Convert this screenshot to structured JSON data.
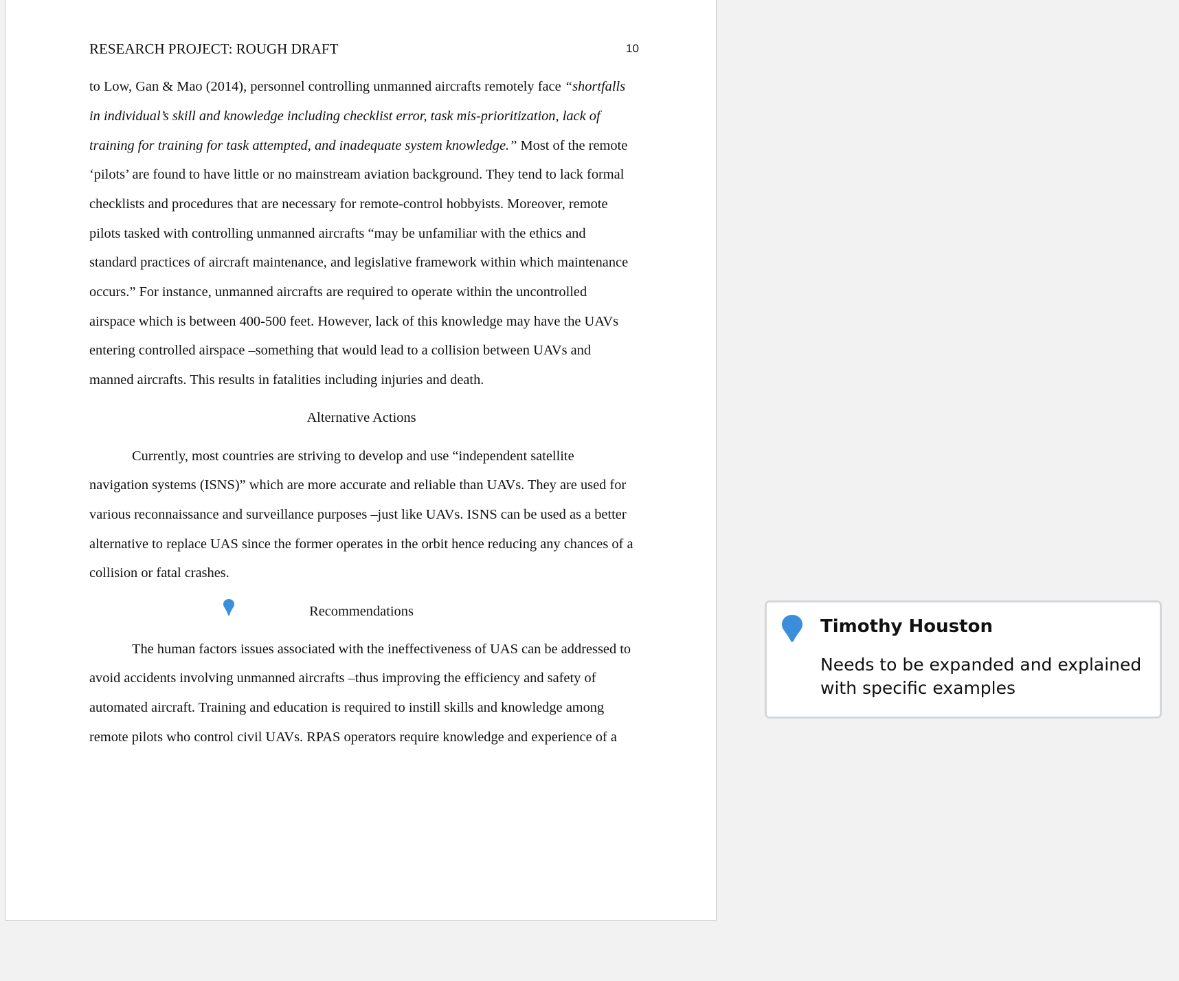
{
  "document": {
    "running_head": "RESEARCH PROJECT: ROUGH DRAFT",
    "page_number": "10",
    "lines": [
      {
        "pre": "to Low, Gan & Mao (2014), personnel controlling unmanned aircrafts remotely face ",
        "italic": "“shortfalls",
        "post": ""
      },
      {
        "pre": "",
        "italic": "in individual’s skill and knowledge including checklist error, task mis-prioritization, lack of",
        "post": ""
      },
      {
        "pre": "",
        "italic": "training for training for task attempted, and inadequate system knowledge.”",
        "post": " Most of the remote"
      },
      {
        "pre": "‘pilots’ are found to have little or no mainstream aviation background. They tend to lack formal",
        "italic": "",
        "post": ""
      },
      {
        "pre": "checklists and procedures that are necessary for remote-control hobbyists. Moreover, remote",
        "italic": "",
        "post": ""
      },
      {
        "pre": "pilots tasked with controlling unmanned aircrafts “may be unfamiliar with the ethics and",
        "italic": "",
        "post": ""
      },
      {
        "pre": "standard practices of aircraft maintenance, and legislative framework within which maintenance",
        "italic": "",
        "post": ""
      },
      {
        "pre": "occurs.” For instance, unmanned aircrafts are required to operate within the uncontrolled",
        "italic": "",
        "post": ""
      },
      {
        "pre": "airspace which is between 400-500 feet. However, lack of this knowledge may have the UAVs",
        "italic": "",
        "post": ""
      },
      {
        "pre": "entering controlled airspace –something that would lead to a collision between UAVs and",
        "italic": "",
        "post": ""
      },
      {
        "pre": "manned aircrafts. This results in fatalities including injuries and death.",
        "italic": "",
        "post": ""
      }
    ],
    "heading_alternative": "Alternative Actions",
    "alt_lines": [
      "Currently, most countries are striving to develop and use “independent satellite",
      "navigation systems (ISNS)” which are more accurate and reliable than UAVs. They are used for",
      "various reconnaissance and surveillance purposes –just like UAVs. ISNS can be used as a better",
      "alternative to replace UAS since the former operates in the orbit hence reducing any chances of a",
      "collision or fatal crashes."
    ],
    "heading_recommendations": "Recommendations",
    "rec_lines": [
      "The human factors issues associated with the ineffectiveness of UAS can be addressed to",
      "avoid accidents involving unmanned aircrafts –thus improving the efficiency and safety of",
      "automated aircraft. Training and education is required to instill skills and knowledge among",
      "remote pilots who control civil UAVs. RPAS operators require knowledge and experience of a"
    ]
  },
  "comment": {
    "author": "Timothy Houston",
    "text": "Needs to be expanded and explained with specific examples",
    "icon": "comment-pin-icon",
    "pin_color": "#3a8edb"
  }
}
